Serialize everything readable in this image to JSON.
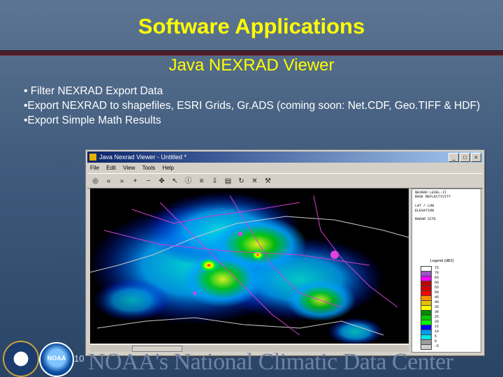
{
  "slide": {
    "title": "Software Applications",
    "subtitle": "Java NEXRAD Viewer",
    "bullets": [
      "• Filter NEXRAD Export Data",
      "•Export NEXRAD to shapefiles, ESRI Grids, Gr.ADS (coming soon: Net.CDF, Geo.TIFF & HDF)",
      "•Export Simple Math Results"
    ],
    "page_number": "10",
    "footer_watermark": "NOAA's National Climatic Data Center",
    "colors": {
      "title": "#ffff00",
      "body_text": "#ffffff",
      "background": "#3f5a7c",
      "rule": "#4a1e2c"
    }
  },
  "app": {
    "window_title": "Java Nexrad Viewer - Untitled *",
    "menus": [
      "File",
      "Edit",
      "View",
      "Tools",
      "Help"
    ],
    "toolbar_icons": [
      "globe-icon",
      "back-icon",
      "forward-icon",
      "zoom-in-icon",
      "zoom-out-icon",
      "pan-icon",
      "select-icon",
      "info-icon",
      "layers-icon",
      "export-icon",
      "filter-icon",
      "refresh-icon",
      "clear-icon",
      "tools-icon"
    ],
    "toolbar_glyphs": [
      "◎",
      "«",
      "»",
      "+",
      "−",
      "✥",
      "↖",
      "ⓘ",
      "≡",
      "⇩",
      "▤",
      "↻",
      "✕",
      "⚒"
    ],
    "metadata_lines": [
      "NEXRAD LEVEL-II",
      "BASE REFLECTIVITY",
      "",
      "LAT / LON",
      "ELEVATION",
      "",
      "RADAR SITE",
      "",
      "",
      "",
      "",
      ""
    ],
    "legend_title": "Legend (dBZ)",
    "legend": [
      {
        "label": "75",
        "color": "#ffffff"
      },
      {
        "label": "70",
        "color": "#9a55c8"
      },
      {
        "label": "65",
        "color": "#ff00ff"
      },
      {
        "label": "60",
        "color": "#c00000"
      },
      {
        "label": "55",
        "color": "#d00000"
      },
      {
        "label": "50",
        "color": "#ff0000"
      },
      {
        "label": "45",
        "color": "#ff9000"
      },
      {
        "label": "40",
        "color": "#e7c000"
      },
      {
        "label": "35",
        "color": "#ffff00"
      },
      {
        "label": "30",
        "color": "#008c00"
      },
      {
        "label": "25",
        "color": "#00c800"
      },
      {
        "label": "20",
        "color": "#00ff00"
      },
      {
        "label": "15",
        "color": "#0000f6"
      },
      {
        "label": "10",
        "color": "#019ff4"
      },
      {
        "label": "5",
        "color": "#04e9e7"
      },
      {
        "label": "0",
        "color": "#9c9c9c"
      },
      {
        "label": "-5",
        "color": "#cfcfcf"
      }
    ]
  },
  "logos": {
    "doc_seal": "Department of Commerce seal",
    "noaa": "NOAA"
  }
}
